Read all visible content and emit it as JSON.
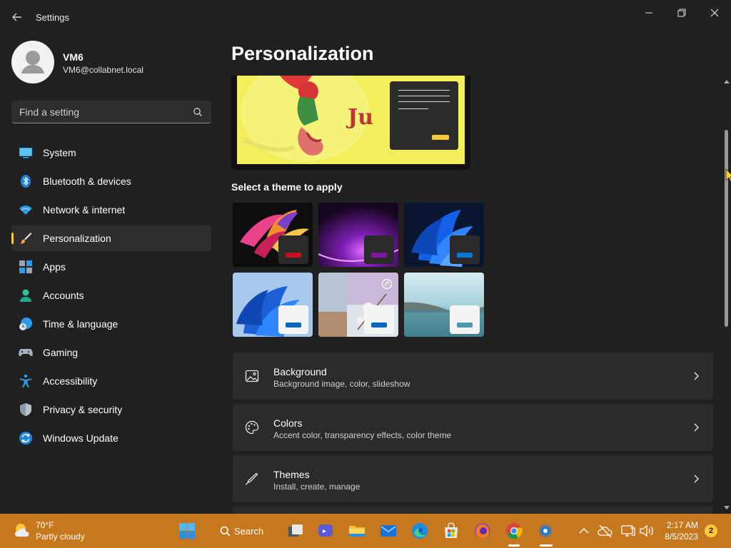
{
  "window": {
    "title": "Settings"
  },
  "profile": {
    "name": "VM6",
    "email": "VM6@collabnet.local"
  },
  "search": {
    "placeholder": "Find a setting"
  },
  "nav": {
    "items": [
      {
        "label": "System",
        "icon": "system-icon"
      },
      {
        "label": "Bluetooth & devices",
        "icon": "bluetooth-icon"
      },
      {
        "label": "Network & internet",
        "icon": "wifi-icon"
      },
      {
        "label": "Personalization",
        "icon": "brush-icon",
        "active": true
      },
      {
        "label": "Apps",
        "icon": "apps-icon"
      },
      {
        "label": "Accounts",
        "icon": "person-icon"
      },
      {
        "label": "Time & language",
        "icon": "clock-globe-icon"
      },
      {
        "label": "Gaming",
        "icon": "controller-icon"
      },
      {
        "label": "Accessibility",
        "icon": "accessibility-icon"
      },
      {
        "label": "Privacy & security",
        "icon": "shield-icon"
      },
      {
        "label": "Windows Update",
        "icon": "update-icon"
      }
    ]
  },
  "main": {
    "title": "Personalization",
    "themes_label": "Select a theme to apply",
    "themes": [
      {
        "name": "glow-theme",
        "swatch": "#c50f1f"
      },
      {
        "name": "captured-motion-theme",
        "swatch": "#7a1aa0"
      },
      {
        "name": "windows-dark-theme",
        "swatch": "#0078d4"
      },
      {
        "name": "windows-light-theme",
        "swatch": "#0067c0"
      },
      {
        "name": "flow-theme",
        "swatch": "#0067c0"
      },
      {
        "name": "sunrise-theme",
        "swatch": "#4a9bb0"
      }
    ],
    "cards": [
      {
        "title": "Background",
        "subtitle": "Background image, color, slideshow",
        "icon": "image-icon"
      },
      {
        "title": "Colors",
        "subtitle": "Accent color, transparency effects, color theme",
        "icon": "palette-icon"
      },
      {
        "title": "Themes",
        "subtitle": "Install, create, manage",
        "icon": "pen-icon"
      }
    ]
  },
  "taskbar": {
    "temperature": "70°F",
    "condition": "Partly cloudy",
    "search_label": "Search",
    "time": "2:17 AM",
    "date": "8/5/2023",
    "notification_count": "2"
  },
  "colors": {
    "accent": "#ffc83d",
    "taskbar": "#c5781e",
    "background": "#202020",
    "card": "#2b2b2b"
  }
}
